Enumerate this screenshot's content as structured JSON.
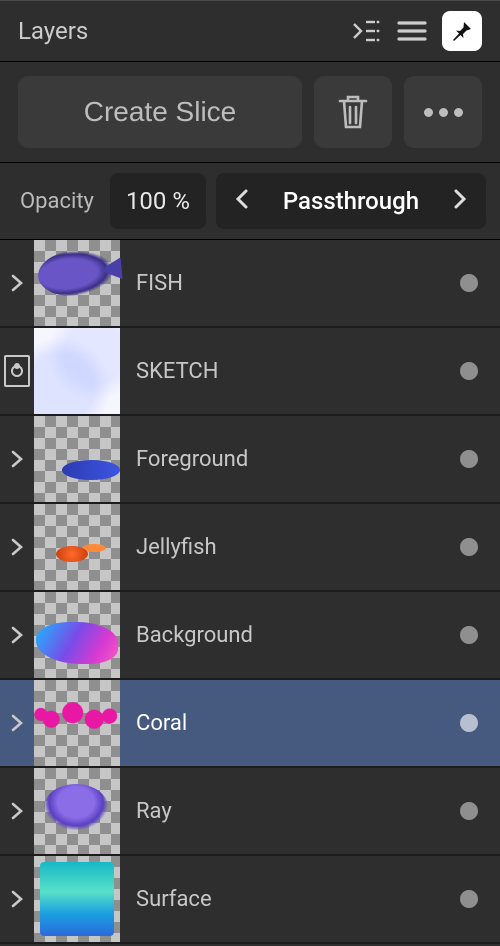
{
  "header": {
    "title": "Layers"
  },
  "toolbar": {
    "create_slice_label": "Create Slice"
  },
  "opacity": {
    "label": "Opacity",
    "value": "100 %"
  },
  "blend": {
    "mode": "Passthrough"
  },
  "layers": [
    {
      "name": "FISH",
      "open": false,
      "visible": true,
      "selected": false,
      "expandable": true,
      "adjust": false,
      "art": "fish"
    },
    {
      "name": "SKETCH",
      "open": false,
      "visible": true,
      "selected": false,
      "expandable": false,
      "adjust": true,
      "art": "sketch"
    },
    {
      "name": "Foreground",
      "open": false,
      "visible": true,
      "selected": false,
      "expandable": true,
      "adjust": false,
      "art": "fore"
    },
    {
      "name": "Jellyfish",
      "open": false,
      "visible": true,
      "selected": false,
      "expandable": true,
      "adjust": false,
      "art": "jelly"
    },
    {
      "name": "Background",
      "open": false,
      "visible": true,
      "selected": false,
      "expandable": true,
      "adjust": false,
      "art": "bg"
    },
    {
      "name": "Coral",
      "open": false,
      "visible": true,
      "selected": true,
      "expandable": true,
      "adjust": false,
      "art": "coral"
    },
    {
      "name": "Ray",
      "open": false,
      "visible": true,
      "selected": false,
      "expandable": true,
      "adjust": false,
      "art": "ray"
    },
    {
      "name": "Surface",
      "open": false,
      "visible": true,
      "selected": false,
      "expandable": true,
      "adjust": false,
      "art": "surface"
    }
  ]
}
